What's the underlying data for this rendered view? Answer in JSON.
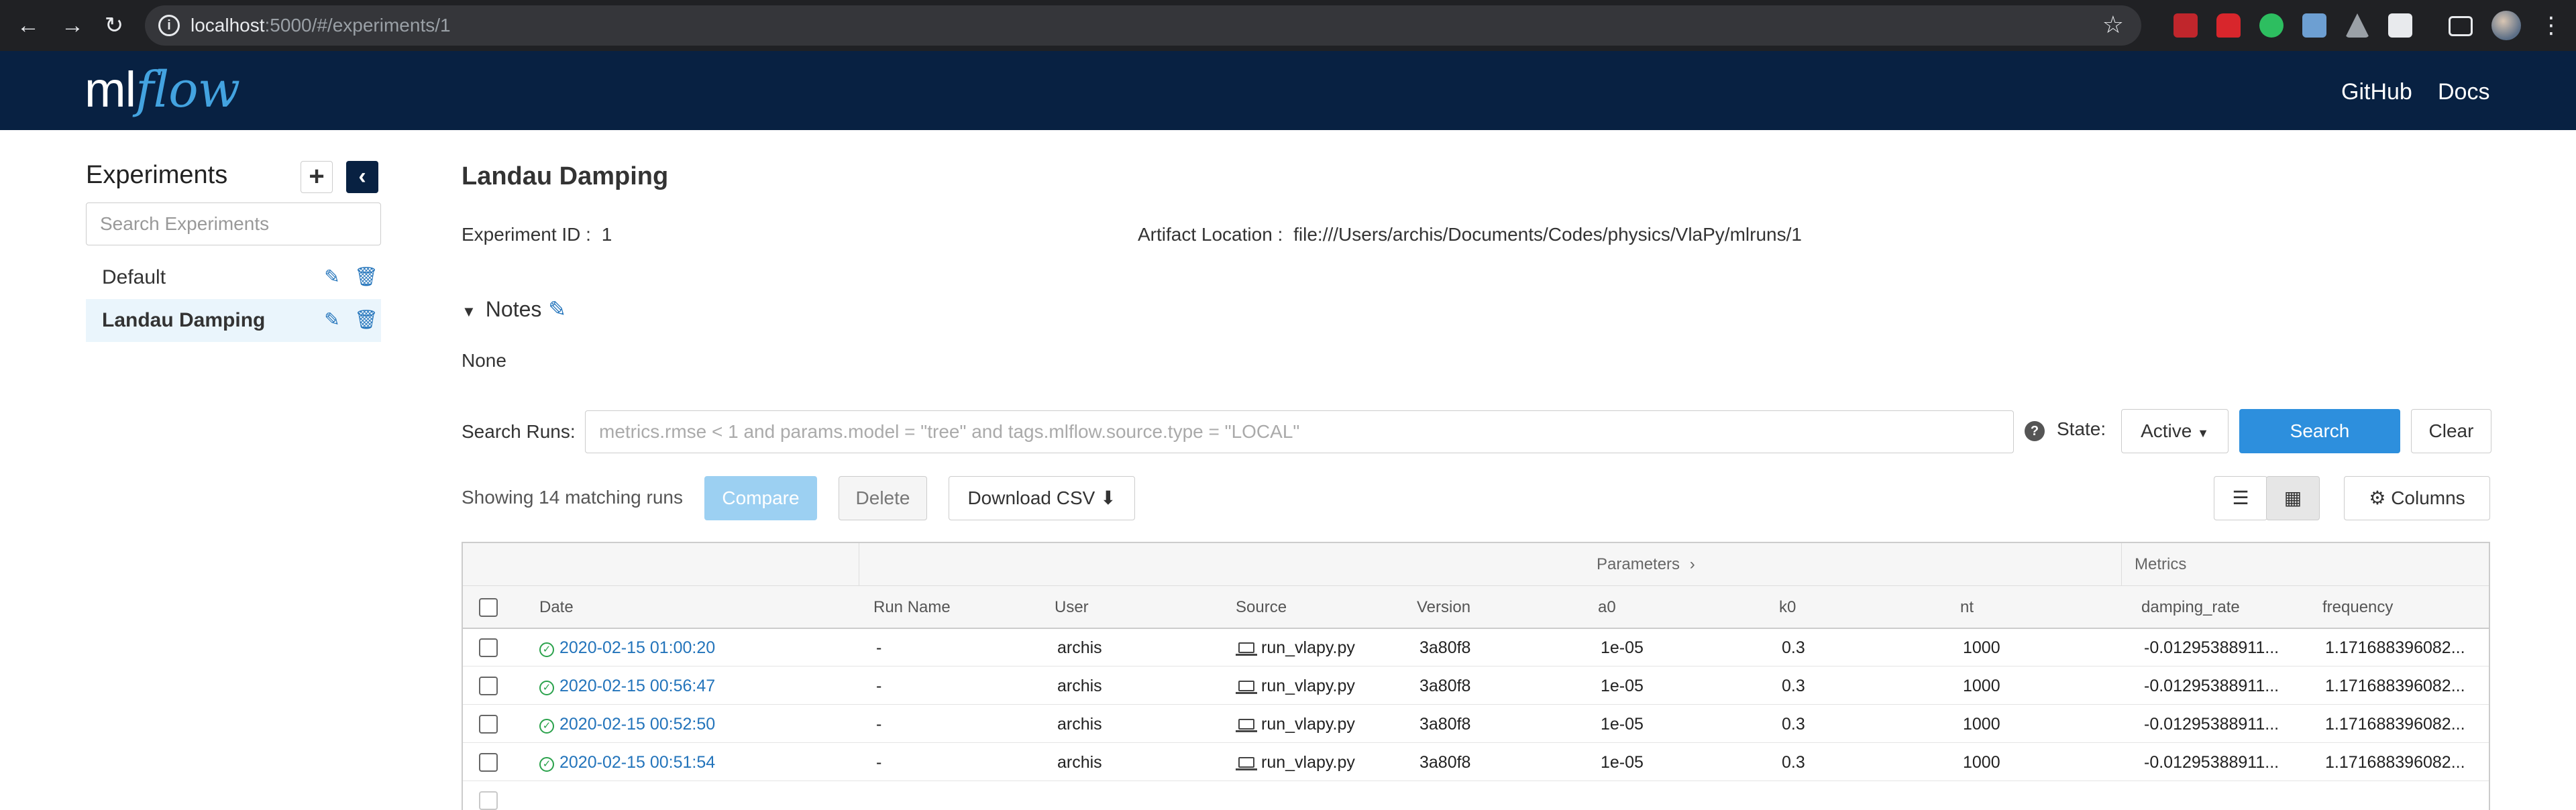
{
  "browser": {
    "url_host": "localhost",
    "url_path": ":5000/#/experiments/1"
  },
  "header": {
    "logo_ml": "ml",
    "logo_flow": "flow",
    "links": [
      "GitHub",
      "Docs"
    ]
  },
  "sidebar": {
    "title": "Experiments",
    "search_placeholder": "Search Experiments",
    "experiments": [
      {
        "name": "Default",
        "active": false
      },
      {
        "name": "Landau Damping",
        "active": true
      }
    ]
  },
  "experiment": {
    "title": "Landau Damping",
    "id_label": "Experiment ID :",
    "id_value": "1",
    "artifact_label": "Artifact Location :",
    "artifact_value": "file:///Users/archis/Documents/Codes/physics/VlaPy/mlruns/1",
    "notes_label": "Notes",
    "notes_value": "None"
  },
  "search": {
    "label": "Search Runs:",
    "placeholder": "metrics.rmse < 1 and params.model = \"tree\" and tags.mlflow.source.type = \"LOCAL\"",
    "state_label": "State:",
    "state_value": "Active",
    "search_button": "Search",
    "clear_button": "Clear"
  },
  "toolbar": {
    "showing": "Showing 14 matching runs",
    "compare": "Compare",
    "delete": "Delete",
    "download_csv": "Download CSV",
    "columns": "Columns"
  },
  "table": {
    "group_headers": {
      "parameters": "Parameters",
      "metrics": "Metrics"
    },
    "columns": [
      "Date",
      "Run Name",
      "User",
      "Source",
      "Version",
      "a0",
      "k0",
      "nt",
      "damping_rate",
      "frequency"
    ],
    "rows": [
      {
        "date": "2020-02-15 01:00:20",
        "run_name": "-",
        "user": "archis",
        "source": "run_vlapy.py",
        "version": "3a80f8",
        "a0": "1e-05",
        "k0": "0.3",
        "nt": "1000",
        "damping_rate": "-0.01295388911...",
        "frequency": "1.171688396082..."
      },
      {
        "date": "2020-02-15 00:56:47",
        "run_name": "-",
        "user": "archis",
        "source": "run_vlapy.py",
        "version": "3a80f8",
        "a0": "1e-05",
        "k0": "0.3",
        "nt": "1000",
        "damping_rate": "-0.01295388911...",
        "frequency": "1.171688396082..."
      },
      {
        "date": "2020-02-15 00:52:50",
        "run_name": "-",
        "user": "archis",
        "source": "run_vlapy.py",
        "version": "3a80f8",
        "a0": "1e-05",
        "k0": "0.3",
        "nt": "1000",
        "damping_rate": "-0.01295388911...",
        "frequency": "1.171688396082..."
      },
      {
        "date": "2020-02-15 00:51:54",
        "run_name": "-",
        "user": "archis",
        "source": "run_vlapy.py",
        "version": "3a80f8",
        "a0": "1e-05",
        "k0": "0.3",
        "nt": "1000",
        "damping_rate": "-0.01295388911...",
        "frequency": "1.171688396082..."
      }
    ]
  },
  "colors": {
    "header_bg": "#082142",
    "accent": "#2d8fdd",
    "link": "#2374bb",
    "success": "#2ba24c"
  }
}
